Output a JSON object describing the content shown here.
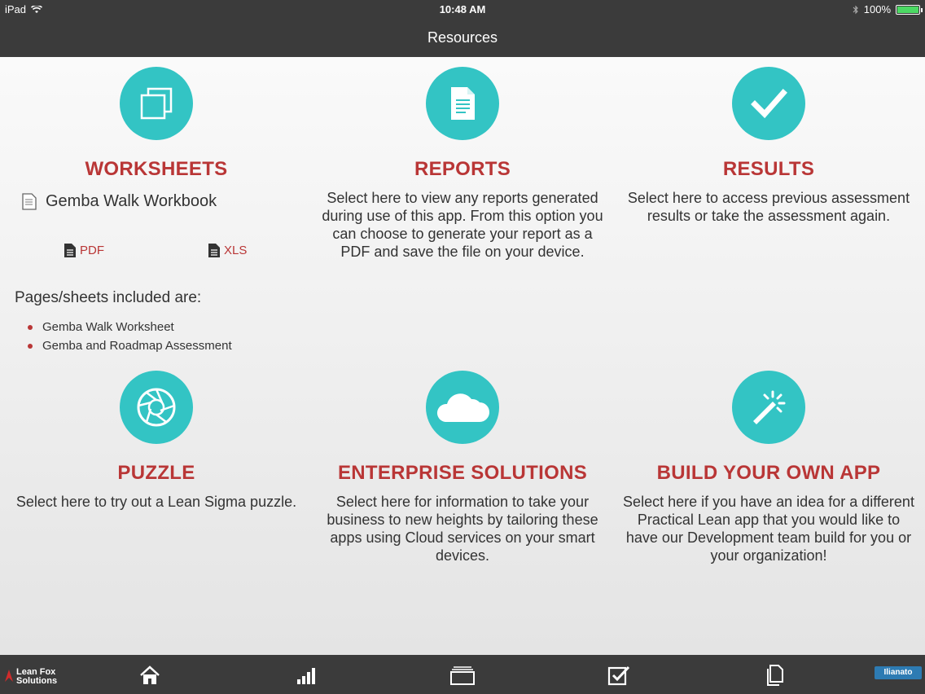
{
  "status": {
    "device": "iPad",
    "time": "10:48 AM",
    "battery": "100%"
  },
  "nav": {
    "title": "Resources"
  },
  "worksheets": {
    "title": "WORKSHEETS",
    "workbook": "Gemba Walk Workbook",
    "pdf_label": "PDF",
    "xls_label": "XLS",
    "pages_label": "Pages/sheets included are:",
    "pages": [
      "Gemba Walk Worksheet",
      "Gemba and Roadmap Assessment"
    ]
  },
  "reports": {
    "title": "REPORTS",
    "desc": "Select here to view any reports generated during use of this app. From this option you can choose to generate your report as a PDF and save the file on your device."
  },
  "results": {
    "title": "RESULTS",
    "desc": "Select here to access previous assessment results or take the assessment again."
  },
  "puzzle": {
    "title": "PUZZLE",
    "desc": "Select here to try out a Lean Sigma puzzle."
  },
  "enterprise": {
    "title": "ENTERPRISE SOLUTIONS",
    "desc": "Select here for information to take your business to new heights by tailoring these apps using Cloud services on your smart devices."
  },
  "build": {
    "title": "BUILD YOUR OWN APP",
    "desc": "Select here if you have an idea for a different Practical Lean app that you would like to have our Development team build for you or your organization!"
  },
  "tabbar": {
    "brand": "Lean Fox Solutions",
    "right_logo": "Ilianato",
    "tabs": [
      "home-icon",
      "chart-icon",
      "layers-icon",
      "checkbox-icon",
      "document-icon"
    ]
  },
  "colors": {
    "accent_teal": "#33c4c4",
    "title_red": "#b93636",
    "bar_dark": "#3b3b3b"
  }
}
